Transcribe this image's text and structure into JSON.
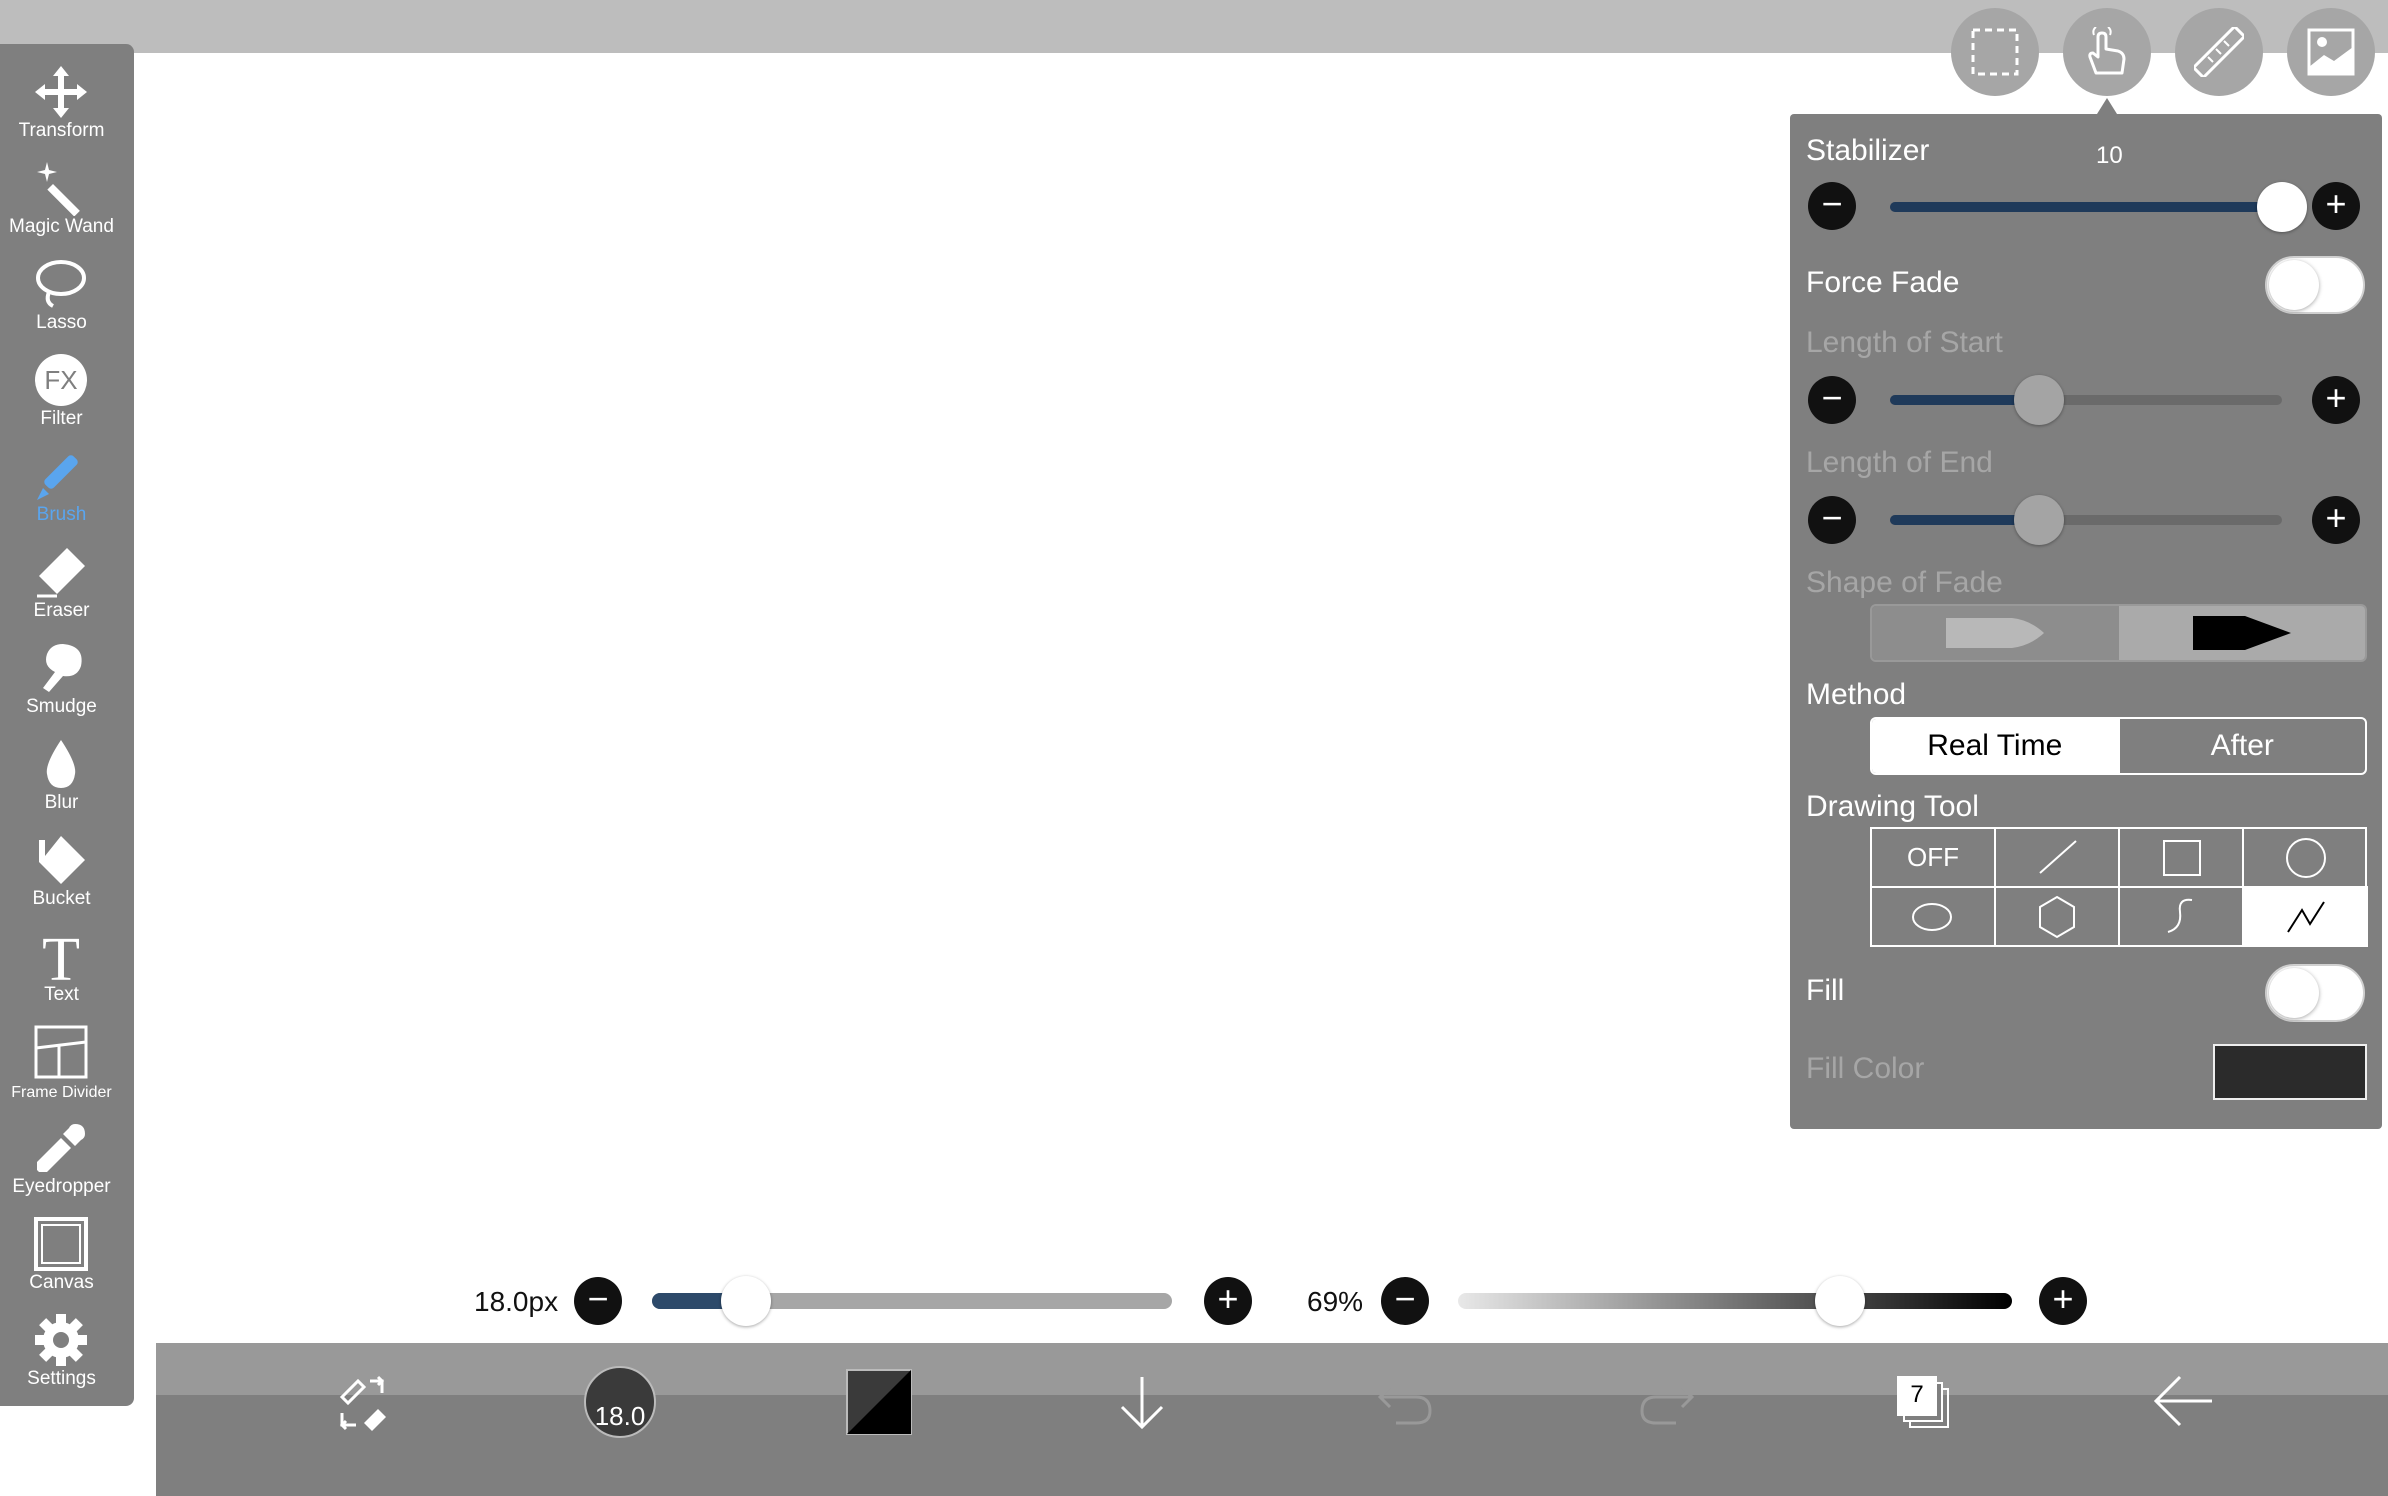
{
  "toolbar": {
    "items": [
      {
        "label": "Transform",
        "icon": "move-arrows-icon"
      },
      {
        "label": "Magic Wand",
        "icon": "magic-wand-icon"
      },
      {
        "label": "Lasso",
        "icon": "lasso-icon"
      },
      {
        "label": "Filter",
        "icon": "fx-filter-icon",
        "glyph": "FX"
      },
      {
        "label": "Brush",
        "icon": "brush-icon",
        "active": true
      },
      {
        "label": "Eraser",
        "icon": "eraser-icon"
      },
      {
        "label": "Smudge",
        "icon": "smudge-icon"
      },
      {
        "label": "Blur",
        "icon": "drop-icon"
      },
      {
        "label": "Bucket",
        "icon": "bucket-icon"
      },
      {
        "label": "Text",
        "icon": "text-icon",
        "glyph": "T"
      },
      {
        "label": "Frame Divider",
        "icon": "frame-divider-icon"
      },
      {
        "label": "Eyedropper",
        "icon": "eyedropper-icon"
      },
      {
        "label": "Canvas",
        "icon": "canvas-icon"
      },
      {
        "label": "Settings",
        "icon": "gear-icon"
      }
    ],
    "active_color": "#5aa5ee"
  },
  "top_buttons": [
    "selection-icon",
    "hand-touch-icon",
    "ruler-icon",
    "image-icon"
  ],
  "panel": {
    "stabilizer": {
      "label": "Stabilizer",
      "value": "10",
      "level": 1.0
    },
    "force_fade": {
      "label": "Force Fade",
      "on": false
    },
    "length_of_start": {
      "label": "Length of Start",
      "level": 0.38
    },
    "length_of_end": {
      "label": "Length of End",
      "level": 0.38
    },
    "shape_of_fade": {
      "label": "Shape of Fade",
      "selected": 1
    },
    "method": {
      "label": "Method",
      "options": [
        "Real Time",
        "After"
      ],
      "selected": "Real Time"
    },
    "drawing_tool": {
      "label": "Drawing Tool",
      "off_label": "OFF",
      "cells": [
        "off",
        "line-icon",
        "rectangle-icon",
        "circle-icon",
        "ellipse-icon",
        "hexagon-icon",
        "curve-icon",
        "polyline-icon"
      ],
      "selected": "polyline-icon"
    },
    "fill": {
      "label": "Fill",
      "on": false
    },
    "fill_color": {
      "label": "Fill Color",
      "color": "#2b2b2b"
    },
    "accent_color": "#1f3a5a"
  },
  "brush_size": {
    "label": "18.0px",
    "level": 0.18
  },
  "opacity": {
    "label": "69%",
    "level": 0.69
  },
  "bottom_bar": {
    "brush_preview_label": "18.0",
    "layers_count": "7"
  }
}
